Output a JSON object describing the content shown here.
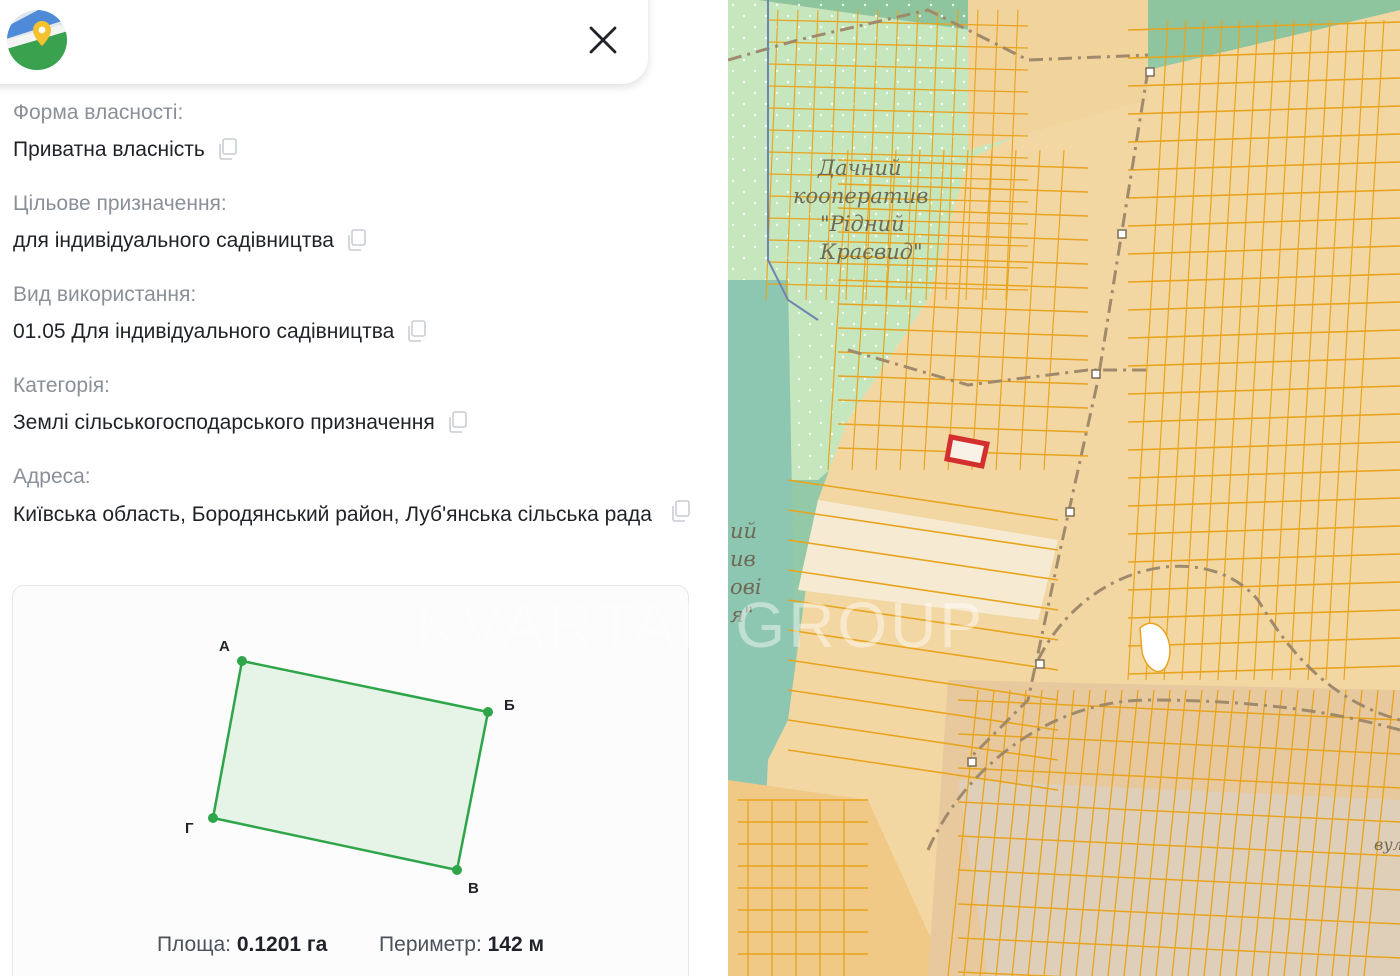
{
  "header": {
    "logo_icon": "map-pin-logo-icon",
    "close_icon": "close-icon"
  },
  "fields": {
    "ownership": {
      "label": "Форма власності:",
      "value": "Приватна власність"
    },
    "purpose": {
      "label": "Цільове призначення:",
      "value": "для індивідуального садівництва"
    },
    "usage": {
      "label": "Вид використання:",
      "value": "01.05 Для індивідуального садівництва"
    },
    "category": {
      "label": "Категорія:",
      "value": "Землі сільськогосподарського призначення"
    },
    "address": {
      "label": "Адреса:",
      "value": "Київська область, Бородянський район, Луб'янська сільська рада"
    }
  },
  "parcel_shape": {
    "vertices": {
      "a": "А",
      "b": "Б",
      "c": "В",
      "d": "Г"
    },
    "area_label": "Площа:",
    "area_value": "0.1201 га",
    "perimeter_label": "Периметр:",
    "perimeter_value": "142 м"
  },
  "map": {
    "area_label_lines": [
      "Дачний",
      "кооператив",
      "\"Рідний",
      "Краєвид\""
    ],
    "left_partial_lines": [
      "ий",
      "ив",
      "ові",
      "я\""
    ],
    "street_partial": "вул",
    "watermark": "KVARTAL GROUP"
  },
  "colors": {
    "parcel_outline": "#2fa54a",
    "parcel_fill": "#e6f4e8",
    "highlight_parcel": "#d32f2f",
    "map_plot_stroke": "#e8a41e",
    "map_plot_fill": "#f3d7a3",
    "map_forest": "#9fd1a4"
  }
}
